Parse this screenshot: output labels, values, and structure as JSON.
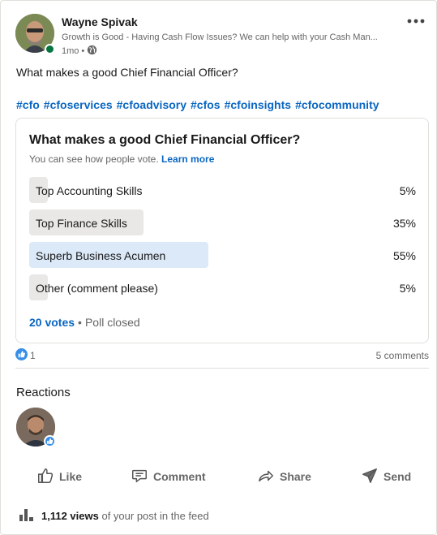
{
  "author": {
    "name": "Wayne Spivak",
    "headline": "Growth is Good - Having Cash Flow Issues? We can help with your Cash Man...",
    "time": "1mo",
    "meta_separator": "•"
  },
  "post": {
    "text": "What makes a good Chief Financial Officer?",
    "hashtags": [
      "#cfo",
      "#cfoservices",
      "#cfoadvisory",
      "#cfos",
      "#cfoinsights",
      "#cfocommunity"
    ]
  },
  "poll": {
    "question": "What makes a good Chief Financial Officer?",
    "visibility_text": "You can see how people vote.",
    "learn_more": "Learn more",
    "options": [
      {
        "label": "Top Accounting Skills",
        "percent_text": "5%",
        "percent": 5,
        "selected": false
      },
      {
        "label": "Top Finance Skills",
        "percent_text": "35%",
        "percent": 35,
        "selected": false
      },
      {
        "label": "Superb Business Acumen",
        "percent_text": "55%",
        "percent": 55,
        "selected": true
      },
      {
        "label": "Other (comment please)",
        "percent_text": "5%",
        "percent": 5,
        "selected": false
      }
    ],
    "votes": "20 votes",
    "separator": "•",
    "status": "Poll closed"
  },
  "social": {
    "like_count": "1",
    "comments": "5 comments"
  },
  "reactions": {
    "title": "Reactions"
  },
  "actions": {
    "like": "Like",
    "comment": "Comment",
    "share": "Share",
    "send": "Send"
  },
  "views": {
    "count": "1,112 views",
    "suffix": "of your post in the feed"
  },
  "colors": {
    "link": "#0a66c2",
    "poll_bar": "#e9e8e6",
    "poll_bar_selected": "#dce9f8",
    "online": "#057642",
    "like_badge": "#378fe9"
  },
  "icons": [
    "more-icon",
    "globe-icon",
    "like-reaction-icon",
    "like-icon",
    "comment-icon",
    "share-icon",
    "send-icon",
    "analytics-icon"
  ]
}
